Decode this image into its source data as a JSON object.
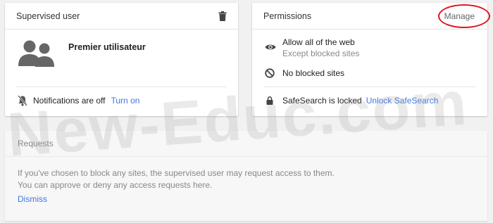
{
  "supervised": {
    "title": "Supervised user",
    "user_name": "Premier utilisateur",
    "notifications_text": "Notifications are off",
    "turn_on": "Turn on"
  },
  "permissions": {
    "title": "Permissions",
    "manage": "Manage",
    "allow_title": "Allow all of the web",
    "allow_sub": "Except blocked sites",
    "no_blocked": "No blocked sites",
    "safesearch_text": "SafeSearch is locked",
    "unlock": "Unlock SafeSearch"
  },
  "requests": {
    "title": "Requests",
    "line1": "If you've chosen to block any sites, the supervised user may request access to them.",
    "line2": "You can approve or deny any access requests here.",
    "dismiss": "Dismiss"
  },
  "watermark": "New-Educ.com",
  "icons": {
    "delete": "trash-icon",
    "avatar": "users-icon",
    "notifications": "bell-off-icon",
    "allow": "eye-icon",
    "blocked": "block-icon",
    "lock": "lock-icon"
  },
  "colors": {
    "link": "#3b78e7",
    "annotation": "#e0141e"
  }
}
